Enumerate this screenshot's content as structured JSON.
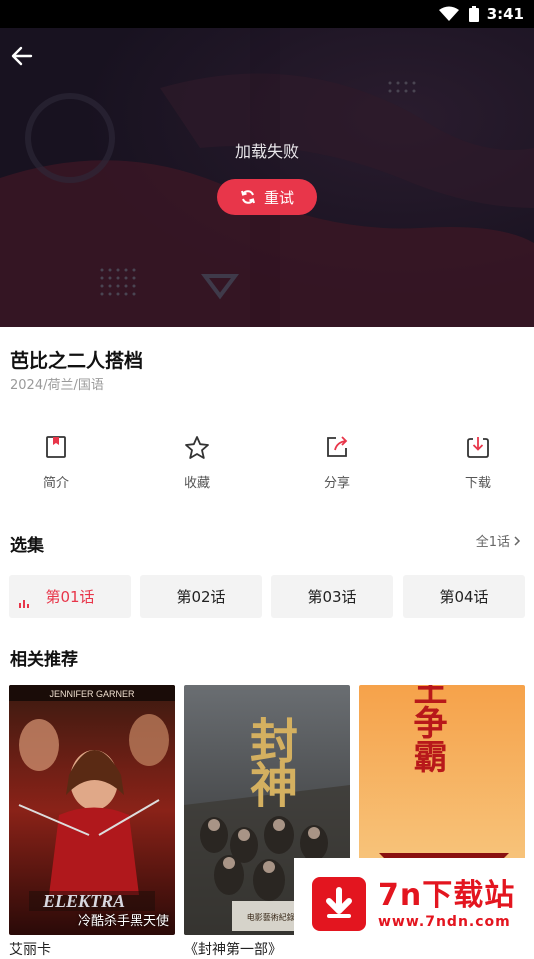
{
  "status_bar": {
    "time": "3:41"
  },
  "player": {
    "error_text": "加载失败",
    "retry_label": "重试"
  },
  "video": {
    "title": "芭比之二人搭档",
    "meta": "2024/荷兰/国语"
  },
  "actions": [
    {
      "label": "简介",
      "icon": "intro-icon"
    },
    {
      "label": "收藏",
      "icon": "star-icon"
    },
    {
      "label": "分享",
      "icon": "share-icon"
    },
    {
      "label": "下载",
      "icon": "download-icon"
    }
  ],
  "episodes": {
    "title": "选集",
    "all_label": "全1话",
    "items": [
      "第01话",
      "第02话",
      "第03话",
      "第04话"
    ],
    "active_index": 0
  },
  "recommend": {
    "title": "相关推荐",
    "items": [
      {
        "name": "艾丽卡",
        "poster_text_top": "JENNIFER GARNER",
        "poster_logo": "ELEKTRA",
        "poster_caption": "冷酷杀手黑天使"
      },
      {
        "name": "《封神第一部》",
        "poster_logo": "封神",
        "poster_caption": "电影藝術紀錄片 封神之路"
      },
      {
        "name": "",
        "poster_logo": "神王争霸"
      }
    ]
  },
  "watermark": {
    "brand": "7n下载站",
    "url": "www.7ndn.com"
  },
  "colors": {
    "accent": "#e8364a",
    "player_bg": "#1b1423"
  }
}
